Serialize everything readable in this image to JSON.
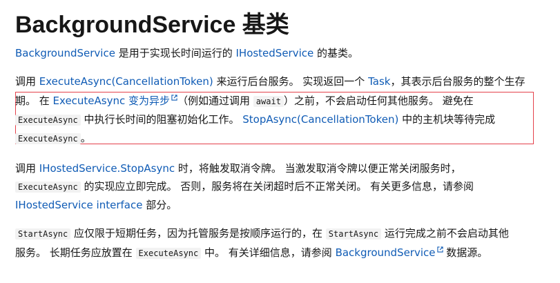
{
  "title": "BackgroundService 基类",
  "p1": {
    "link1": "BackgroundService",
    "text1": " 是用于实现长时间运行的 ",
    "link2": "IHostedService",
    "text2": " 的基类。"
  },
  "p2": {
    "l1_text1": "调用 ",
    "l1_link1": "ExecuteAsync(CancellationToken)",
    "l1_text2": " 来运行后台服务。 实现返回一个 ",
    "l1_link2": "Task",
    "l1_text3": "，其表示后台服务的整个生存",
    "l2_text1": "期。 在 ",
    "l2_link1": "ExecuteAsync 变为异步",
    "l2_text2": "（例如通过调用 ",
    "l2_code1": "await",
    "l2_text3": "）之前，不会启动任何其他服务。 避免在",
    "l3_code1": "ExecuteAsync",
    "l3_text1": " 中执行长时间的阻塞初始化工作。 ",
    "l3_link1": "StopAsync(CancellationToken)",
    "l3_text2": " 中的主机块等待完成",
    "l4_code1": "ExecuteAsync",
    "l4_text1": "。"
  },
  "p3": {
    "l1_text1": "调用 ",
    "l1_link1": "IHostedService.StopAsync",
    "l1_text2": " 时，将触发取消令牌。 当激发取消令牌以便正常关闭服务时，",
    "l2_code1": "ExecuteAsync",
    "l2_text1": " 的实现应立即完成。 否则，服务将在关闭超时后不正常关闭。 有关更多信息，请参阅",
    "l3_link1": "IHostedService interface",
    "l3_text1": " 部分。"
  },
  "p4": {
    "l1_code1": "StartAsync",
    "l1_text1": " 应仅限于短期任务，因为托管服务是按顺序运行的，在 ",
    "l1_code2": "StartAsync",
    "l1_text2": " 运行完成之前不会启动其他",
    "l2_text1": "服务。 长期任务应放置在 ",
    "l2_code1": "ExecuteAsync",
    "l2_text2": " 中。 有关详细信息，请参阅 ",
    "l2_link1": "BackgroundService",
    "l2_text3": " 数据源。"
  },
  "colors": {
    "link": "#0f5bb5",
    "highlight_border": "#e4404a",
    "code_bg": "#f2f2f2"
  },
  "icons": [
    "external-link-icon"
  ]
}
